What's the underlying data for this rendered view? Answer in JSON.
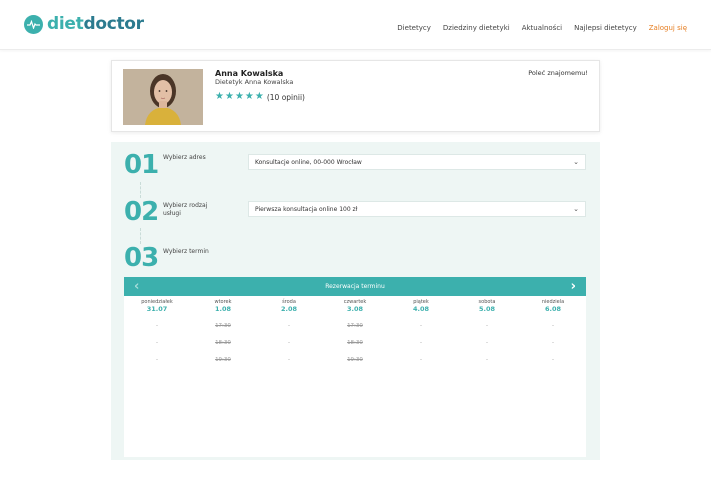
{
  "brand": {
    "diet": "diet",
    "doctor": "doctor"
  },
  "nav": {
    "items": [
      "Dietetycy",
      "Dziedziny dietetyki",
      "Aktualności",
      "Najlepsi dietetycy"
    ],
    "login": "Zaloguj się"
  },
  "profile": {
    "name": "Anna Kowalska",
    "title": "Dietetyk Anna Kowalska",
    "rating_stars": 5,
    "reviews": "(10 opinii)",
    "recommend": "Poleć znajomemu!"
  },
  "steps": [
    {
      "num": "01",
      "label": "Wybierz adres",
      "value": "Konsultacje online, 00-000 Wrocław"
    },
    {
      "num": "02",
      "label": "Wybierz rodzaj usługi",
      "value": "Pierwsza konsultacja online 100 zł"
    },
    {
      "num": "03",
      "label": "Wybierz termin"
    }
  ],
  "calendar": {
    "title": "Rezerwacja terminu",
    "prev": "‹",
    "next": "›",
    "days": [
      {
        "name": "poniedziałek",
        "date": "31.07",
        "slots": [
          "-",
          "-",
          "-"
        ]
      },
      {
        "name": "wtorek",
        "date": "1.08",
        "slots": [
          "17:30",
          "18:30",
          "19:30"
        ]
      },
      {
        "name": "środa",
        "date": "2.08",
        "slots": [
          "-",
          "-",
          "-"
        ]
      },
      {
        "name": "czwartek",
        "date": "3.08",
        "slots": [
          "17:30",
          "18:30",
          "19:30"
        ]
      },
      {
        "name": "piątek",
        "date": "4.08",
        "slots": [
          "-",
          "-",
          "-"
        ]
      },
      {
        "name": "sobota",
        "date": "5.08",
        "slots": [
          "-",
          "-",
          "-"
        ]
      },
      {
        "name": "niedziela",
        "date": "6.08",
        "slots": [
          "-",
          "-",
          "-"
        ]
      }
    ]
  },
  "colors": {
    "accent": "#3cb0ad",
    "login": "#e67e22",
    "panel": "#eef6f4"
  }
}
